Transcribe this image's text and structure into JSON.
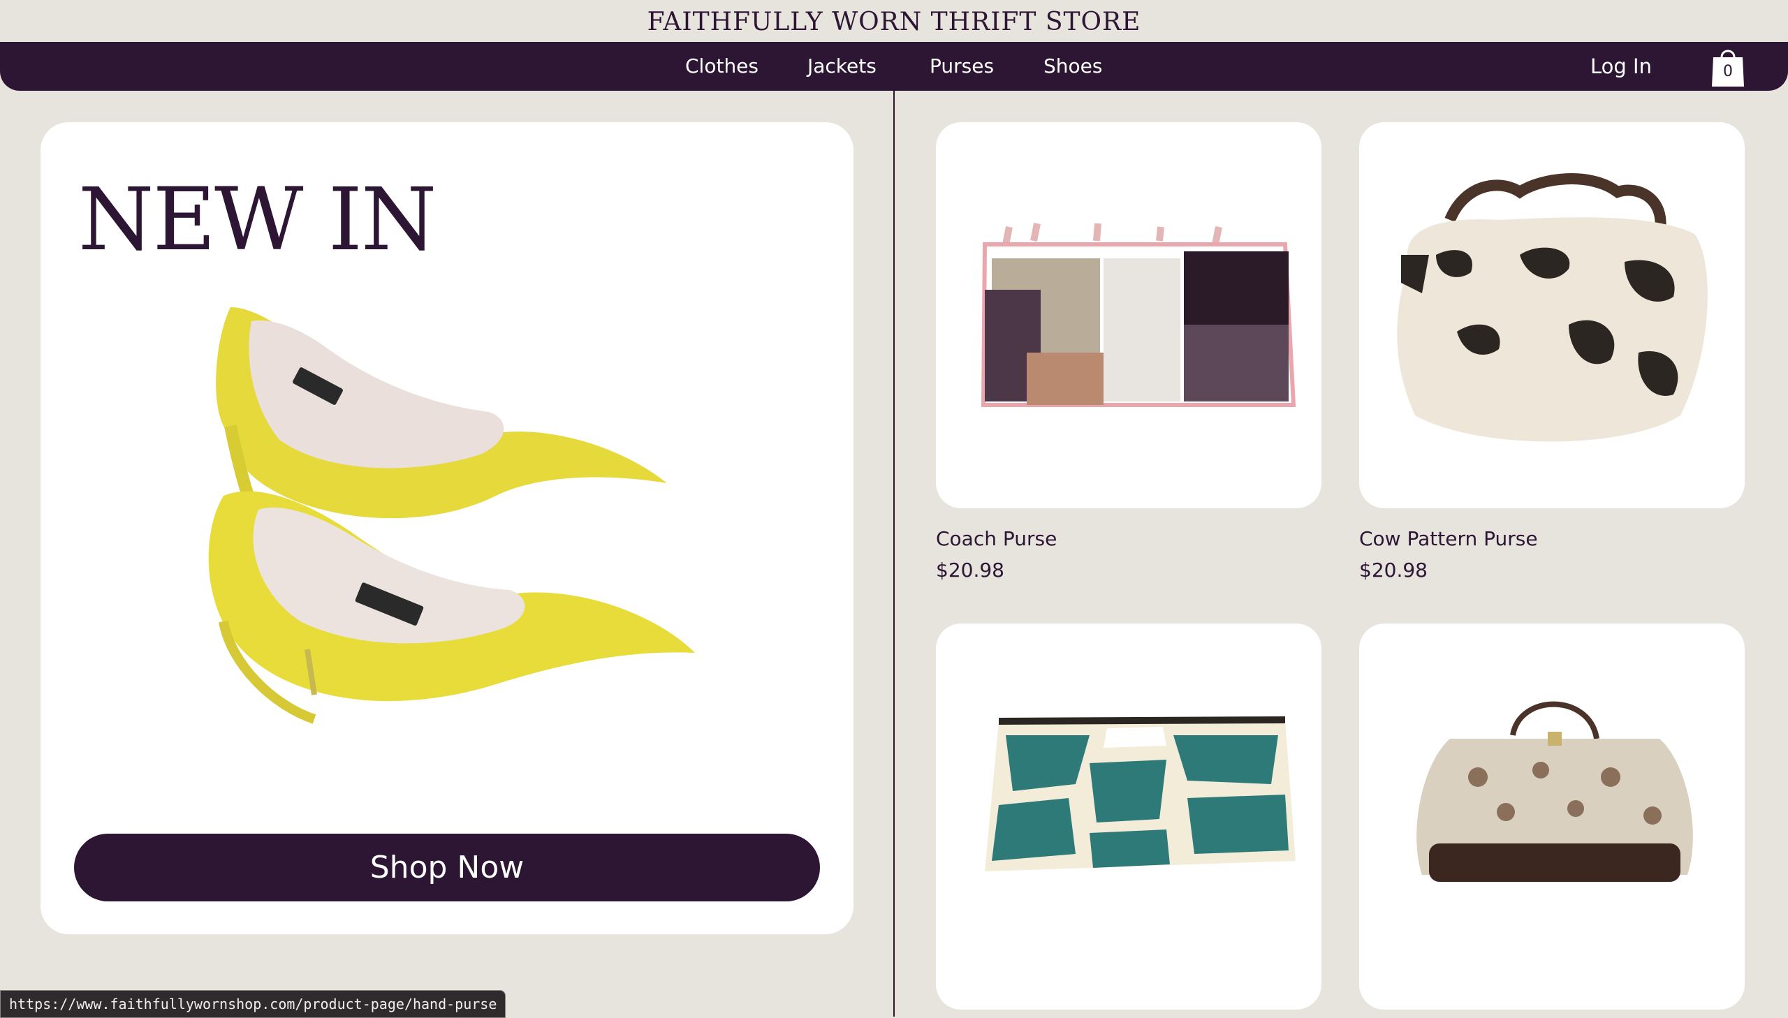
{
  "header": {
    "store_title": "FAITHFULLY WORN THRIFT STORE"
  },
  "nav": {
    "items": [
      {
        "label": "Clothes"
      },
      {
        "label": "Jackets"
      },
      {
        "label": "Purses"
      },
      {
        "label": "Shoes"
      }
    ],
    "login_label": "Log In",
    "cart_count": "0"
  },
  "hero": {
    "title": "NEW IN",
    "button_label": "Shop Now"
  },
  "products": [
    {
      "name": "Coach Purse",
      "price": "$20.98"
    },
    {
      "name": "Cow Pattern Purse",
      "price": "$20.98"
    },
    {
      "name": "",
      "price": ""
    },
    {
      "name": "",
      "price": ""
    }
  ],
  "status_bar": {
    "url": "https://www.faithfullywornshop.com/product-page/hand-purse"
  },
  "colors": {
    "brand": "#2d1634",
    "background": "#e7e3dd",
    "card": "#ffffff"
  }
}
